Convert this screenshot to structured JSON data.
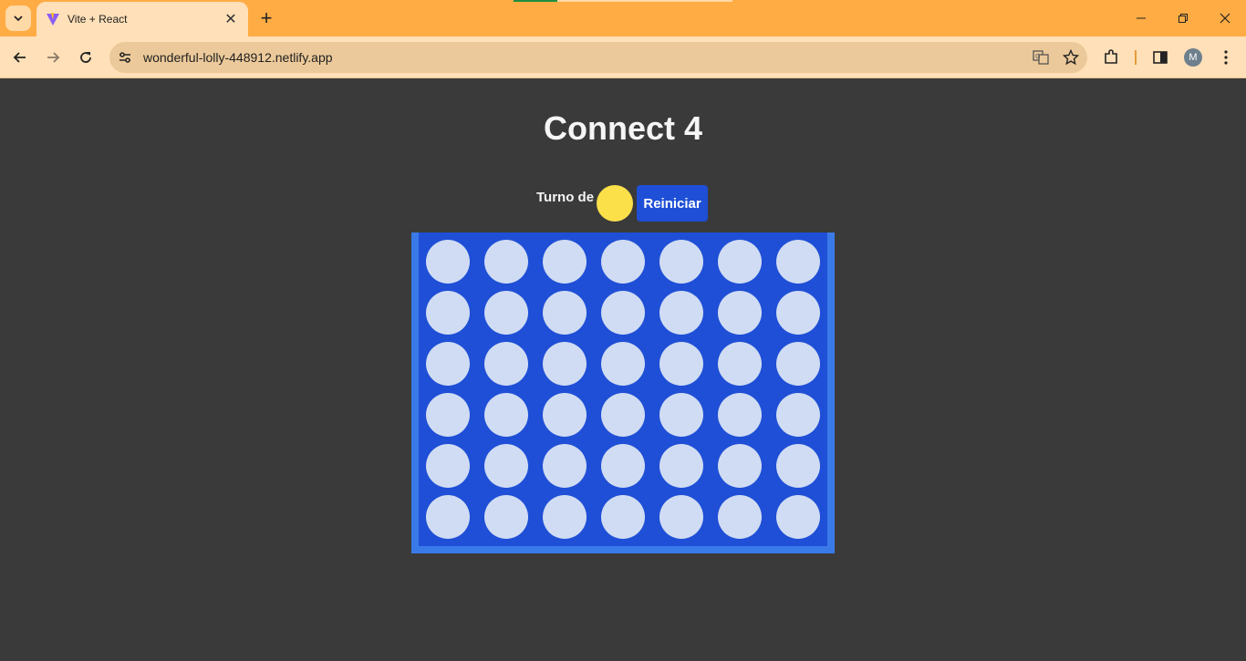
{
  "browser": {
    "tab_title": "Vite + React",
    "url": "wonderful-lolly-448912.netlify.app",
    "profile_initial": "M"
  },
  "page": {
    "title": "Connect 4",
    "turn_label": "Turno de",
    "current_player_color": "#fbe04a",
    "reset_label": "Reiniciar"
  },
  "board": {
    "columns": 7,
    "rows": 6,
    "cells": [
      [
        "empty",
        "empty",
        "empty",
        "empty",
        "empty",
        "empty",
        "empty"
      ],
      [
        "empty",
        "empty",
        "empty",
        "empty",
        "empty",
        "empty",
        "empty"
      ],
      [
        "empty",
        "empty",
        "empty",
        "empty",
        "empty",
        "empty",
        "empty"
      ],
      [
        "empty",
        "empty",
        "empty",
        "empty",
        "empty",
        "empty",
        "empty"
      ],
      [
        "empty",
        "empty",
        "empty",
        "empty",
        "empty",
        "empty",
        "empty"
      ],
      [
        "empty",
        "empty",
        "empty",
        "empty",
        "empty",
        "empty",
        "empty"
      ]
    ]
  },
  "colors": {
    "empty_cell": "#d0dcf3",
    "board": "#1f4fd6",
    "board_frame": "#3a7ae8",
    "yellow": "#fbe04a",
    "page_bg": "#3a3a3a"
  }
}
